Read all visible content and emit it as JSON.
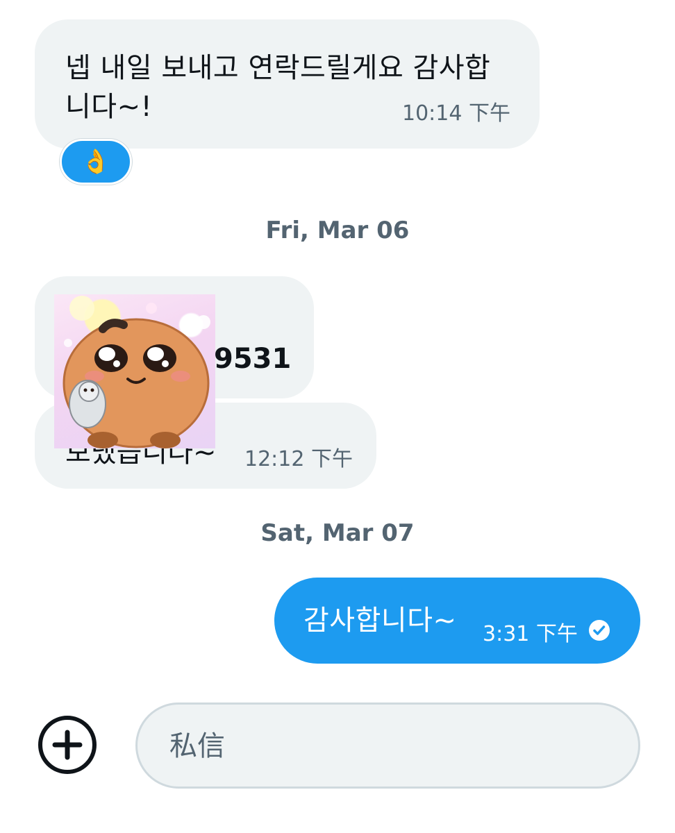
{
  "messages": {
    "recv1": {
      "text": "넵 내일 보내고 연락드릴게요 감사합니다~!",
      "time": "10:14 下午",
      "reaction": "👌"
    },
    "date1": "Fri, Mar 06",
    "recv2": {
      "partial_text": "9531"
    },
    "recv3": {
      "partial_text": "보냈습니다~",
      "time": "12:12 下午"
    },
    "date2": "Sat, Mar 07",
    "sent1": {
      "text": "감사합니다~",
      "time": "3:31 下午"
    }
  },
  "composer": {
    "placeholder": "私信"
  },
  "colors": {
    "accent": "#1d9bf0",
    "bubble_received": "#eff3f4",
    "secondary_text": "#536471"
  },
  "icons": {
    "add": "plus-circle-icon",
    "read_receipt": "check-circle-icon"
  }
}
